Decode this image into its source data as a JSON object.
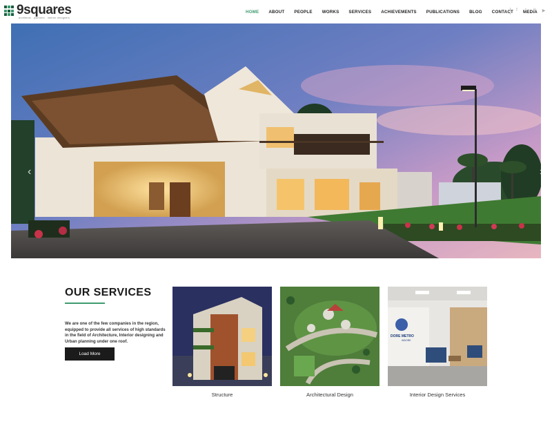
{
  "header": {
    "logo_text": "9squares",
    "logo_tagline": "architects · planners · interior designers",
    "nav": [
      {
        "label": "HOME",
        "active": true
      },
      {
        "label": "ABOUT"
      },
      {
        "label": "PEOPLE"
      },
      {
        "label": "WORKS"
      },
      {
        "label": "SERVICES"
      },
      {
        "label": "ACHIEVEMENTS"
      },
      {
        "label": "PUBLICATIONS"
      },
      {
        "label": "BLOG"
      },
      {
        "label": "CONTACT"
      },
      {
        "label": "MEDIA"
      }
    ],
    "social_icons": [
      "facebook-icon",
      "twitter-icon",
      "linkedin-icon",
      "youtube-icon"
    ],
    "social_glyphs": [
      "f",
      "t",
      "in",
      "▶"
    ]
  },
  "hero": {
    "prev_glyph": "‹",
    "next_glyph": "›"
  },
  "services": {
    "title": "OUR SERVICES",
    "description": "We are one of the few companies in the region, equipped to provide all services of high standards in the field of Architecture, Interior designing and Urban planning under one roof.",
    "button_label": "Load More",
    "cards": [
      {
        "label": "Structure"
      },
      {
        "label": "Architectural Design"
      },
      {
        "label": "Interior Design Services",
        "sign_text": "DORE METRO",
        "sign_sub": "INDORE"
      }
    ]
  },
  "colors": {
    "accent": "#3d9b6f",
    "button_bg": "#1b1b1b"
  }
}
